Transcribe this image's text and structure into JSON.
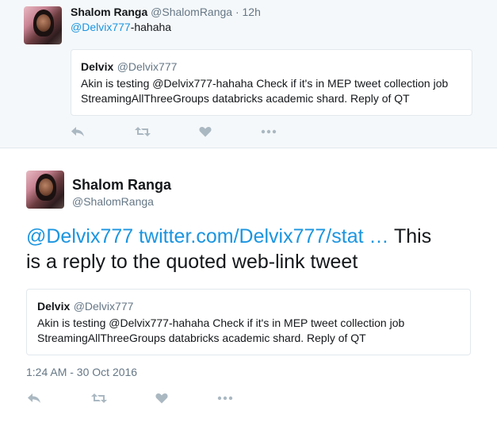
{
  "timeline_tweet": {
    "author_name": "Shalom Ranga",
    "author_handle": "@ShalomRanga",
    "time": "· 12h",
    "mention": "@Delvix777",
    "text_rest": "-hahaha",
    "quote": {
      "author_name": "Delvix",
      "author_handle": "@Delvix777",
      "text_line1": "Akin is testing @Delvix777-hahaha Check if it's in MEP tweet collection job",
      "text_line2": "StreamingAllThreeGroups databricks academic shard. Reply of QT"
    }
  },
  "detail_tweet": {
    "author_name": "Shalom Ranga",
    "author_handle": "@ShalomRanga",
    "mention": "@Delvix777",
    "url": "twitter.com/Delvix777/stat …",
    "text_rest_line1": " This",
    "text_line2": "is a reply to the quoted web-link tweet",
    "quote": {
      "author_name": "Delvix",
      "author_handle": "@Delvix777",
      "text_line1": "Akin is testing @Delvix777-hahaha Check if it's in MEP tweet collection job",
      "text_line2": "StreamingAllThreeGroups databricks academic shard. Reply of QT"
    },
    "timestamp": "1:24 AM - 30 Oct 2016"
  },
  "icons": [
    "reply-icon",
    "retweet-icon",
    "like-icon",
    "more-icon"
  ],
  "colors": {
    "link": "#1b95e0",
    "icon": "#aab8c2",
    "name": "#14171a",
    "handle": "#657786"
  }
}
